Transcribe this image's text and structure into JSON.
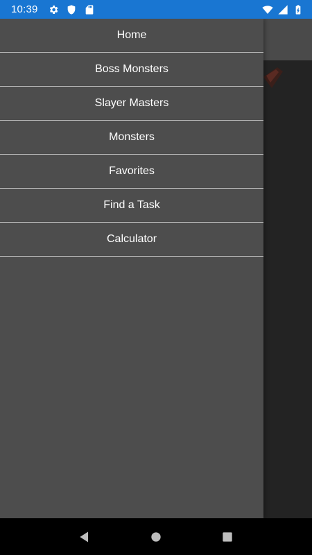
{
  "status_bar": {
    "time": "10:39",
    "left_icons": [
      "settings-icon",
      "shield-icon",
      "sd-card-icon"
    ],
    "right_icons": [
      "wifi-icon",
      "cell-signal-icon",
      "battery-icon"
    ],
    "background_color": "#1976d2"
  },
  "drawer": {
    "items": [
      {
        "label": "Home"
      },
      {
        "label": "Boss Monsters"
      },
      {
        "label": "Slayer Masters"
      },
      {
        "label": "Monsters"
      },
      {
        "label": "Favorites"
      },
      {
        "label": "Find a Task"
      },
      {
        "label": "Calculator"
      }
    ],
    "background_color": "#4d4d4d"
  },
  "nav_bar": {
    "buttons": [
      "back-icon",
      "home-icon",
      "recents-icon"
    ]
  }
}
